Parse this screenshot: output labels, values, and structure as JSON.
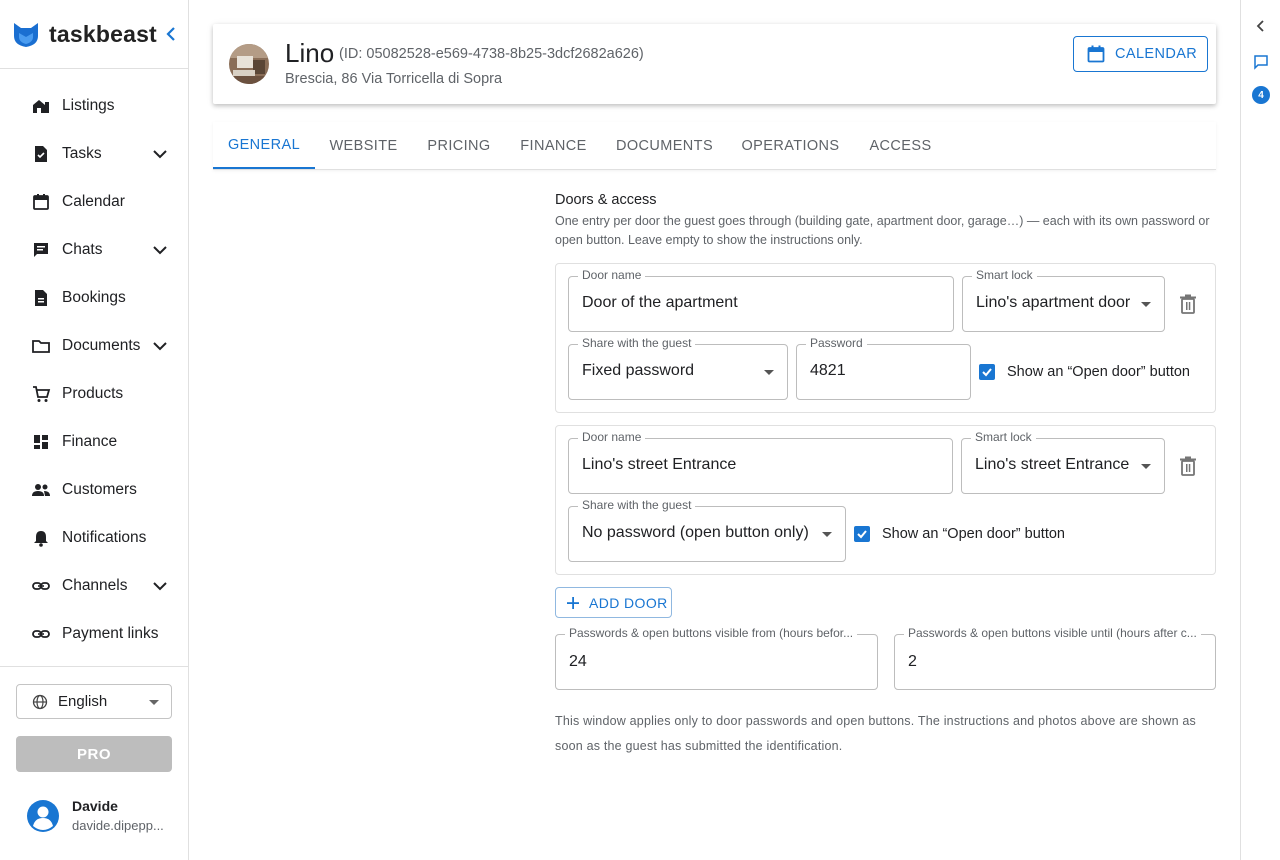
{
  "app": {
    "name": "taskbeast"
  },
  "sidebar": {
    "items": [
      {
        "label": "Listings",
        "icon": "listings-icon",
        "has_chevron": false
      },
      {
        "label": "Tasks",
        "icon": "tasks-icon",
        "has_chevron": true
      },
      {
        "label": "Calendar",
        "icon": "calendar-icon",
        "has_chevron": false
      },
      {
        "label": "Chats",
        "icon": "chat-icon",
        "has_chevron": true
      },
      {
        "label": "Bookings",
        "icon": "bookings-icon",
        "has_chevron": false
      },
      {
        "label": "Documents",
        "icon": "folder-icon",
        "has_chevron": true
      },
      {
        "label": "Products",
        "icon": "cart-icon",
        "has_chevron": false
      },
      {
        "label": "Finance",
        "icon": "dashboard-icon",
        "has_chevron": false
      },
      {
        "label": "Customers",
        "icon": "people-icon",
        "has_chevron": false
      },
      {
        "label": "Notifications",
        "icon": "bell-icon",
        "has_chevron": false
      },
      {
        "label": "Channels",
        "icon": "link-icon",
        "has_chevron": true
      },
      {
        "label": "Payment links",
        "icon": "link-icon",
        "has_chevron": false
      }
    ],
    "language": "English",
    "pro_label": "PRO",
    "user": {
      "name": "Davide",
      "email": "davide.dipepp..."
    }
  },
  "rail": {
    "badge_count": "4"
  },
  "header": {
    "name": "Lino",
    "id_text": "(ID: 05082528-e569-4738-8b25-3dcf2682a626)",
    "address": "Brescia, 86 Via Torricella di Sopra",
    "calendar_button": "CALENDAR"
  },
  "tabs": [
    "GENERAL",
    "WEBSITE",
    "PRICING",
    "FINANCE",
    "DOCUMENTS",
    "OPERATIONS",
    "ACCESS"
  ],
  "active_tab": "GENERAL",
  "doors_section": {
    "title": "Doors & access",
    "description": "One entry per door the guest goes through (building gate, apartment door, garage…) — each with its own password or open button. Leave empty to show the instructions only.",
    "door_name_label": "Door name",
    "smart_lock_label": "Smart lock",
    "share_label": "Share with the guest",
    "password_label": "Password",
    "open_door_label": "Show an “Open door” button",
    "doors": [
      {
        "name": "Door of the apartment",
        "smart_lock": "Lino's apartment door",
        "share": "Fixed password",
        "password": "4821",
        "open_button": true
      },
      {
        "name": "Lino's street Entrance",
        "smart_lock": "Lino's street Entrance",
        "share": "No password (open button only)",
        "open_button": true
      }
    ],
    "add_door_label": "ADD DOOR",
    "visible_from_label": "Passwords & open buttons visible from (hours befor...",
    "visible_from_value": "24",
    "visible_until_label": "Passwords & open buttons visible until (hours after c...",
    "visible_until_value": "2",
    "footer_note": "This window applies only to door passwords and open buttons. The instructions and photos above are shown as soon as the guest has submitted the identification."
  },
  "colors": {
    "accent": "#1976d2",
    "text": "#202124",
    "muted": "#5f6368",
    "pro_disabled": "#bdbdbd"
  }
}
